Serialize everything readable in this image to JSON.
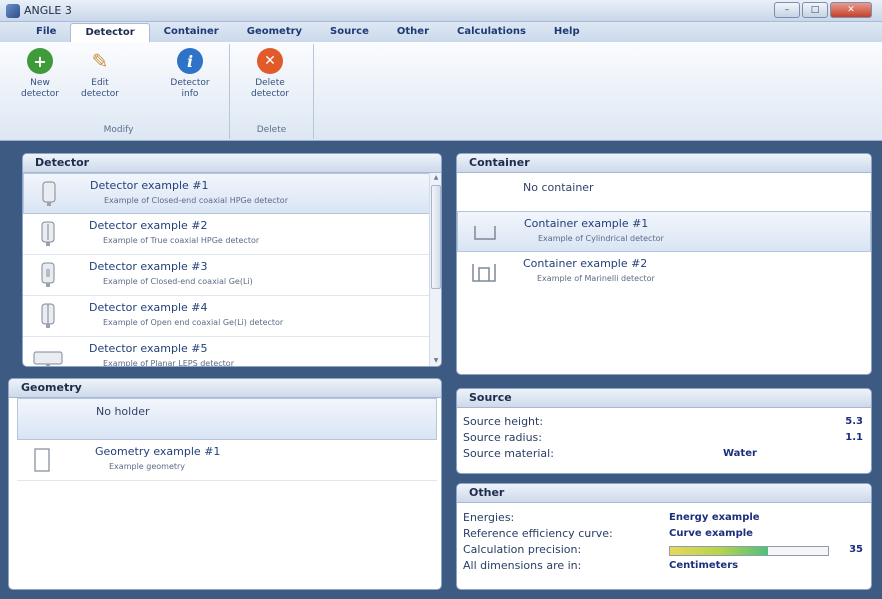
{
  "window": {
    "title": "ANGLE 3"
  },
  "menu": [
    "File",
    "Detector",
    "Container",
    "Geometry",
    "Source",
    "Other",
    "Calculations",
    "Help"
  ],
  "ribbon": {
    "buttons": [
      {
        "line1": "New",
        "line2": "detector",
        "icon": "plus-icon",
        "color": "#3f9a3a"
      },
      {
        "line1": "Edit",
        "line2": "detector",
        "icon": "pencil-icon",
        "color": "#d9a24a"
      },
      {
        "line1": "Detector",
        "line2": "info",
        "icon": "info-icon",
        "color": "#2f73c9"
      },
      {
        "line1": "Delete",
        "line2": "detector",
        "icon": "delete-icon",
        "color": "#e05a2a"
      }
    ],
    "groups": [
      "Modify",
      "Delete"
    ]
  },
  "detector_panel": {
    "title": "Detector",
    "items": [
      {
        "title": "Detector example #1",
        "sub": "Example of Closed-end coaxial HPGe detector"
      },
      {
        "title": "Detector example #2",
        "sub": "Example of True coaxial HPGe detector"
      },
      {
        "title": "Detector example #3",
        "sub": "Example of Closed-end coaxial Ge(Li)"
      },
      {
        "title": "Detector example #4",
        "sub": "Example of Open end coaxial Ge(Li) detector"
      },
      {
        "title": "Detector example #5",
        "sub": "Example of Planar LEPS detector"
      }
    ]
  },
  "container_panel": {
    "title": "Container",
    "none_label": "No container",
    "items": [
      {
        "title": "Container example #1",
        "sub": "Example of Cylindrical detector"
      },
      {
        "title": "Container example #2",
        "sub": "Example of Marinelli detector"
      }
    ]
  },
  "geometry_panel": {
    "title": "Geometry",
    "none_label": "No holder",
    "items": [
      {
        "title": "Geometry example #1",
        "sub": "Example geometry"
      }
    ]
  },
  "source_panel": {
    "title": "Source",
    "rows": [
      {
        "label": "Source height:",
        "value": "5.3"
      },
      {
        "label": "Source radius:",
        "value": "1.1"
      },
      {
        "label": "Source material:",
        "value": "Water"
      }
    ]
  },
  "other_panel": {
    "title": "Other",
    "rows": [
      {
        "label": "Energies:",
        "value": "Energy example"
      },
      {
        "label": "Reference efficiency curve:",
        "value": "Curve example"
      },
      {
        "label": "Calculation precision:",
        "value": "35"
      },
      {
        "label": "All dimensions are in:",
        "value": "Centimeters"
      }
    ],
    "precision_fraction": 0.62
  }
}
